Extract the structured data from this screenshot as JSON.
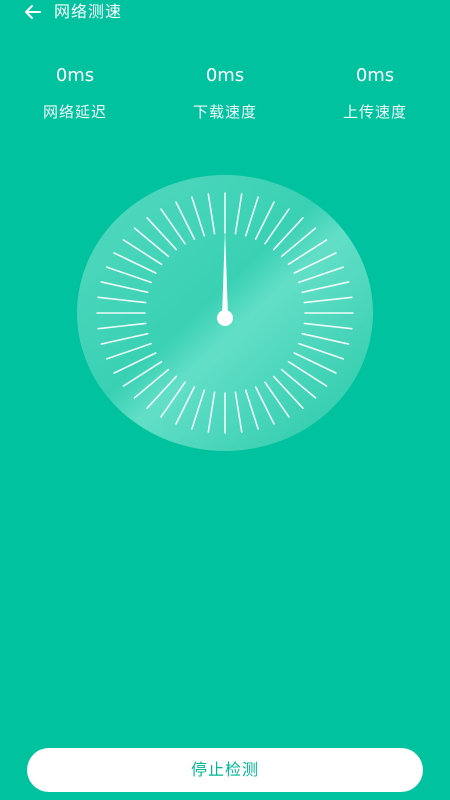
{
  "header": {
    "title": "网络测速",
    "back_icon": "arrow-left-icon"
  },
  "stats": [
    {
      "value": "0ms",
      "label": "网络延迟"
    },
    {
      "value": "0ms",
      "label": "下载速度"
    },
    {
      "value": "0ms",
      "label": "上传速度"
    }
  ],
  "gauge": {
    "tick_count": 48,
    "needle_value": 0
  },
  "footer": {
    "stop_label": "停止检测"
  },
  "colors": {
    "background": "#00c29f",
    "button_text": "#00b896"
  }
}
